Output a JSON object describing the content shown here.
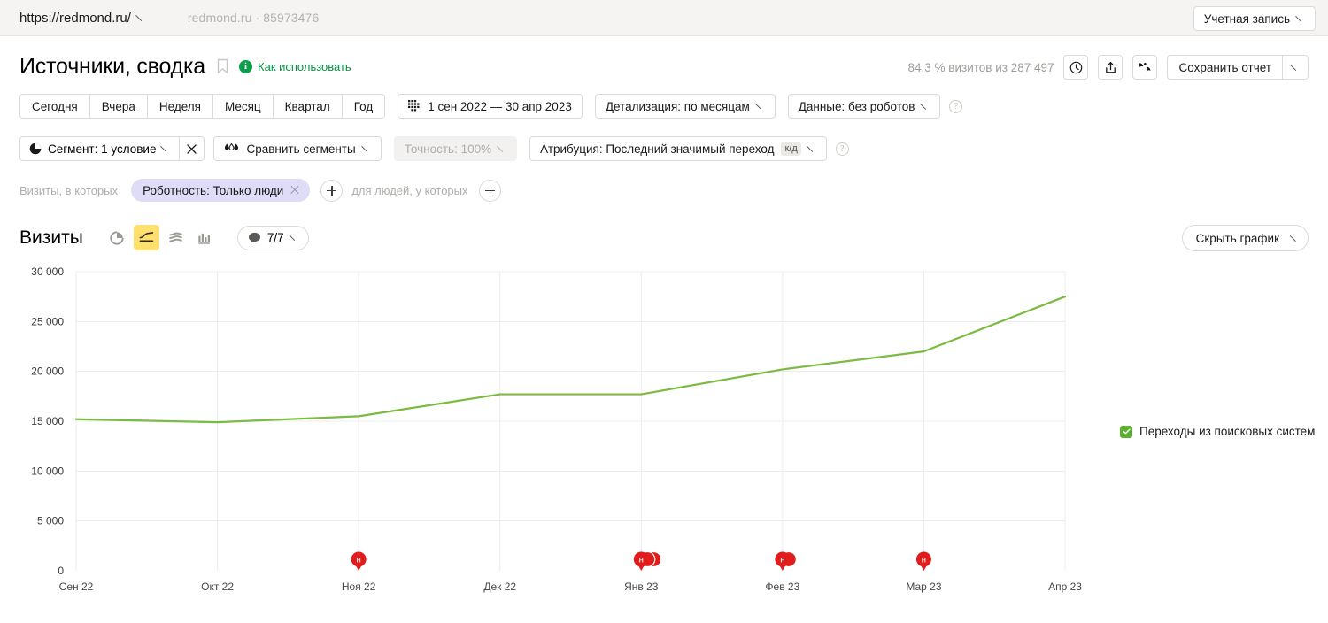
{
  "topbar": {
    "site_url": "https://redmond.ru/",
    "site_meta": "redmond.ru · 85973476",
    "account_label": "Учетная запись"
  },
  "header": {
    "title": "Источники, сводка",
    "howto_label": "Как использовать",
    "info_glyph": "i",
    "visits_stat": "84,3 % визитов из 287 497",
    "save_report_label": "Сохранить отчет",
    "icons": [
      "clock-icon",
      "share-icon",
      "compare-icon"
    ]
  },
  "periods": {
    "buttons": [
      "Сегодня",
      "Вчера",
      "Неделя",
      "Месяц",
      "Квартал",
      "Год"
    ],
    "date_range": "1 сен 2022 — 30 апр 2023",
    "detail_label": "Детализация: по месяцам",
    "data_label": "Данные: без роботов"
  },
  "segment_row": {
    "segment_label": "Сегмент: 1 условие",
    "compare_label": "Сравнить сегменты",
    "accuracy_label": "Точность: 100%",
    "attribution_label": "Атрибуция: Последний значимый переход",
    "attribution_badge": "к/д"
  },
  "filters": {
    "prefix_label": "Визиты, в которых",
    "chip_label": "Роботность: Только люди",
    "middle_label": "для людей, у которых"
  },
  "chart_toolbar": {
    "metric_title": "Визиты",
    "view_icons": [
      {
        "name": "pie-chart-view-icon",
        "active": false
      },
      {
        "name": "line-chart-view-icon",
        "active": true
      },
      {
        "name": "area-chart-view-icon",
        "active": false
      },
      {
        "name": "bar-chart-view-icon",
        "active": false
      }
    ],
    "goals_label": "7/7",
    "hide_chart_label": "Скрыть график"
  },
  "chart_data": {
    "type": "line",
    "title": "Визиты",
    "xlabel": "",
    "ylabel": "",
    "grid": true,
    "legend_position": "right",
    "categories": [
      "Сен 22",
      "Окт 22",
      "Ноя 22",
      "Дек 22",
      "Янв 23",
      "Фев 23",
      "Мар 23",
      "Апр 23"
    ],
    "ylim": [
      0,
      30000
    ],
    "yticks": [
      "0",
      "5 000",
      "10 000",
      "15 000",
      "20 000",
      "25 000",
      "30 000"
    ],
    "ytick_values": [
      0,
      5000,
      10000,
      15000,
      20000,
      25000,
      30000
    ],
    "series": [
      {
        "name": "Переходы из поисковых систем",
        "color": "#7cbb42",
        "checked": true,
        "values": [
          15200,
          14900,
          15500,
          17700,
          17700,
          20200,
          22000,
          27500
        ]
      }
    ],
    "annotations": [
      {
        "category": "Ноя 22",
        "letter": "н",
        "count": 1
      },
      {
        "category": "Янв 23",
        "letter": "н",
        "count": 3
      },
      {
        "category": "Фев 23",
        "letter": "н",
        "count": 2
      },
      {
        "category": "Мар 23",
        "letter": "н",
        "count": 1
      }
    ],
    "annotation_color": "#e01c1c"
  }
}
